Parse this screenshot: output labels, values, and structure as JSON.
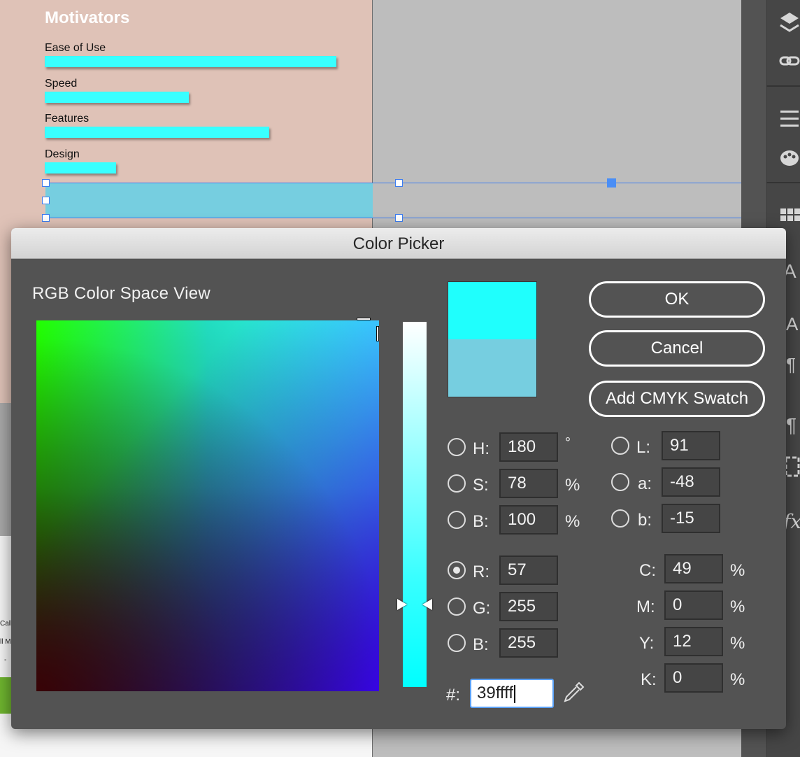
{
  "canvas": {
    "chart_title": "Motivators",
    "bars": [
      {
        "label": "Ease of Use",
        "value": 417
      },
      {
        "label": "Speed",
        "value": 206
      },
      {
        "label": "Features",
        "value": 321
      },
      {
        "label": "Design",
        "value": 102
      }
    ],
    "bar_color": "#39ffff",
    "selected_fill": "#76cee0",
    "lower_fragments": [
      "Call",
      "ll M",
      "-"
    ]
  },
  "toolstrip": {
    "icons": [
      "layers-icon",
      "links-icon",
      "align-icon",
      "color-palette-icon",
      "swatches-icon",
      "character-icon",
      "paragraph-styles-icon",
      "paragraph-icon",
      "transform-icon",
      "fx-icon"
    ]
  },
  "dialog": {
    "title": "Color Picker",
    "space_label": "RGB Color Space View",
    "buttons": {
      "ok": "OK",
      "cancel": "Cancel",
      "add_swatch": "Add CMYK Swatch"
    },
    "hsb": {
      "h": {
        "label": "H:",
        "value": "180",
        "unit": "°"
      },
      "s": {
        "label": "S:",
        "value": "78",
        "unit": "%"
      },
      "b": {
        "label": "B:",
        "value": "100",
        "unit": "%"
      }
    },
    "lab": {
      "l": {
        "label": "L:",
        "value": "91"
      },
      "a": {
        "label": "a:",
        "value": "-48"
      },
      "b": {
        "label": "b:",
        "value": "-15"
      }
    },
    "rgb": {
      "r": {
        "label": "R:",
        "value": "57"
      },
      "g": {
        "label": "G:",
        "value": "255"
      },
      "b": {
        "label": "B:",
        "value": "255"
      },
      "selected": "R"
    },
    "cmyk": {
      "c": {
        "label": "C:",
        "value": "49",
        "unit": "%"
      },
      "m": {
        "label": "M:",
        "value": "0",
        "unit": "%"
      },
      "y": {
        "label": "Y:",
        "value": "12",
        "unit": "%"
      },
      "k": {
        "label": "K:",
        "value": "0",
        "unit": "%"
      }
    },
    "hex": {
      "label": "#:",
      "value": "39ffff"
    },
    "new_color": "#1ffffd",
    "old_color": "#76cee0"
  }
}
